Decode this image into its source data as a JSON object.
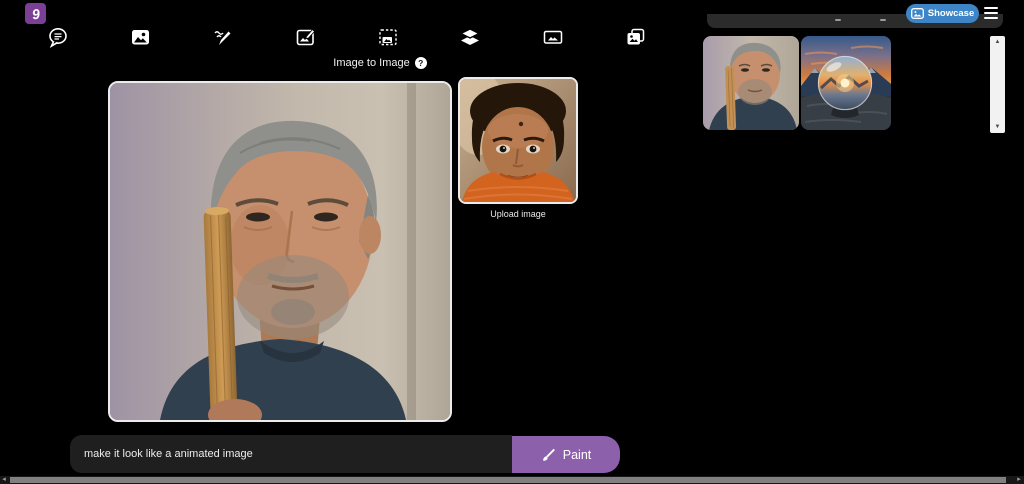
{
  "branding": {
    "logo_glyph": "9"
  },
  "topbar": {
    "showcase_label": "Showcase"
  },
  "toolbar": {
    "items": [
      {
        "name": "chat-tool",
        "icon": "speech-bubble-icon"
      },
      {
        "name": "text-to-image-tool",
        "icon": "photo-icon"
      },
      {
        "name": "sketch-tool",
        "icon": "scribble-pen-icon"
      },
      {
        "name": "image-to-image-tool",
        "icon": "photo-edit-icon"
      },
      {
        "name": "selection-tool",
        "icon": "photo-selection-icon"
      },
      {
        "name": "layers-tool",
        "icon": "layers-icon"
      },
      {
        "name": "frame-tool",
        "icon": "framed-photo-icon"
      },
      {
        "name": "gallery-tool",
        "icon": "photo-stack-icon"
      }
    ]
  },
  "workspace": {
    "title": "Image to Image",
    "help_glyph": "?",
    "upload_label": "Upload image"
  },
  "prompt": {
    "value": "make it look like a animated image",
    "paint_label": "Paint"
  },
  "colors": {
    "background": "#000000",
    "paint_button": "#8d60ab",
    "showcase_button": "#3d85c6",
    "logo": "#7c3f98",
    "prompt_input_bg": "#1f1f1f",
    "panel_bar": "#2b2b2b"
  }
}
